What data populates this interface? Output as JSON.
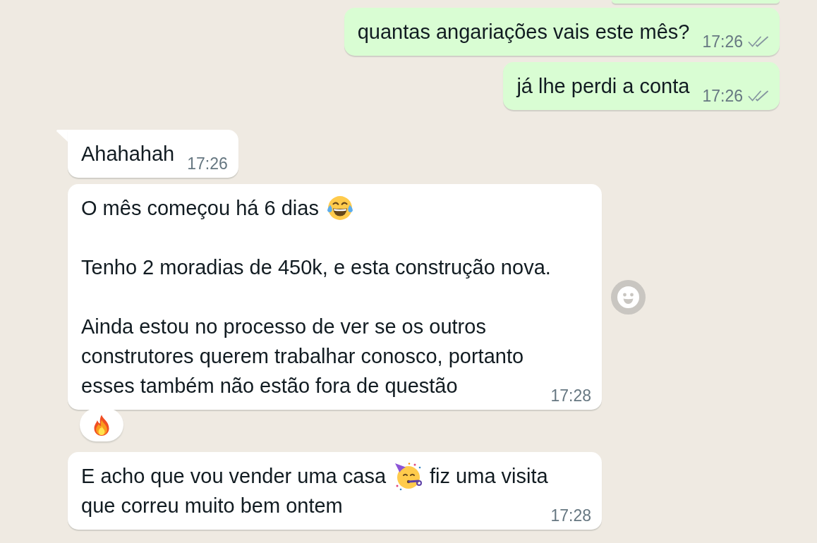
{
  "messages": [
    {
      "kind": "outgoing",
      "cut_off": true
    },
    {
      "kind": "outgoing",
      "cut_off": false,
      "tail": false,
      "react_button": false,
      "paragraphs": [
        {
          "lines": [
            {
              "parts": [
                {
                  "kind": "text",
                  "text": "quantas angariações vais este mês?"
                }
              ]
            }
          ]
        }
      ],
      "time": "17:26",
      "delivered": true,
      "read": false
    },
    {
      "kind": "outgoing",
      "cut_off": false,
      "tail": false,
      "react_button": false,
      "paragraphs": [
        {
          "lines": [
            {
              "parts": [
                {
                  "kind": "text",
                  "text": "já lhe perdi a conta"
                }
              ]
            }
          ]
        }
      ],
      "time": "17:26",
      "delivered": true,
      "read": false
    },
    {
      "kind": "incoming",
      "cut_off": false,
      "tail": true,
      "react_button": false,
      "paragraphs": [
        {
          "lines": [
            {
              "parts": [
                {
                  "kind": "text",
                  "text": "Ahahahah"
                }
              ]
            }
          ]
        }
      ],
      "time": "17:26"
    },
    {
      "kind": "incoming",
      "cut_off": false,
      "tail": false,
      "react_button": true,
      "paragraphs": [
        {
          "lines": [
            {
              "parts": [
                {
                  "kind": "text",
                  "text": "O mês começou há 6 dias"
                },
                {
                  "kind": "laughing"
                }
              ]
            }
          ]
        },
        {
          "lines": [
            {
              "parts": [
                {
                  "kind": "text",
                  "text": "Tenho 2 moradias de 450k, e esta construção nova."
                }
              ]
            }
          ]
        },
        {
          "lines": [
            {
              "parts": [
                {
                  "kind": "text",
                  "text": "Ainda estou no processo de ver se os outros"
                }
              ]
            },
            {
              "parts": [
                {
                  "kind": "text",
                  "text": "construtores querem trabalhar conosco, portanto"
                }
              ]
            },
            {
              "parts": [
                {
                  "kind": "text",
                  "text": "esses também não estão fora de questão"
                }
              ]
            }
          ]
        }
      ],
      "time": "17:28",
      "reactions": [
        {
          "kind": "fire"
        }
      ]
    },
    {
      "kind": "incoming",
      "cut_off": false,
      "tail": false,
      "react_button": false,
      "paragraphs": [
        {
          "lines": [
            {
              "parts": [
                {
                  "kind": "text",
                  "text": "E acho que vou vender uma casa"
                },
                {
                  "kind": "partying"
                },
                {
                  "kind": "text",
                  "text": "fiz uma visita"
                }
              ]
            },
            {
              "parts": [
                {
                  "kind": "text",
                  "text": "que correu muito bem ontem"
                }
              ]
            }
          ]
        }
      ],
      "time": "17:28"
    }
  ]
}
